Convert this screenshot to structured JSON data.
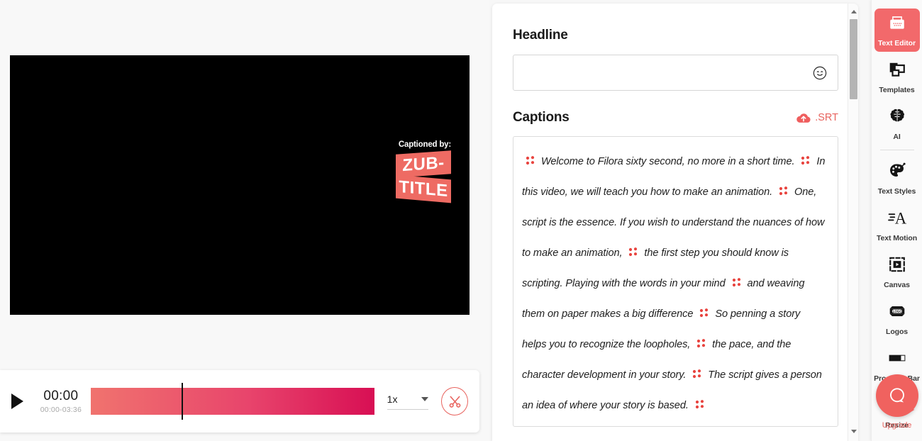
{
  "preview": {
    "watermark": {
      "caption": "Captioned by:",
      "line1": "ZUB-",
      "line2": "TITLE"
    }
  },
  "player": {
    "play_icon": "play-icon",
    "current_time": "00:00",
    "time_range": "00:00-03:36",
    "speed_value": "1x",
    "split_icon": "scissors-icon",
    "track_gradient_from": "#f0736e",
    "track_gradient_to": "#d80f54"
  },
  "editor": {
    "headline": {
      "title": "Headline",
      "value": "",
      "placeholder": "",
      "emoji_icon": "smiley-icon"
    },
    "captions": {
      "title": "Captions",
      "srt_label": ".SRT",
      "srt_icon": "cloud-upload-icon",
      "segments": [
        "Welcome to Filora sixty second, no more in a short time.",
        "In this video, we will teach you how to make an animation.",
        "One, script is the essence. If you wish to understand the nuances of how to make an animation,",
        "the first step you should know is scripting. Playing with the words in your mind",
        "and weaving them on paper makes a big difference",
        "So penning a story helps you to recognize the loopholes,",
        "the pace, and the character development in your story.",
        "The script gives a person an idea of where your story is based.",
        ""
      ]
    }
  },
  "sidebar": {
    "items": [
      {
        "label": "Text Editor",
        "icon": "text-editor-icon",
        "active": true
      },
      {
        "label": "Templates",
        "icon": "templates-icon",
        "active": false
      },
      {
        "label": "AI",
        "icon": "brain-icon",
        "active": false
      },
      {
        "label": "Text Styles",
        "icon": "palette-icon",
        "active": false
      },
      {
        "label": "Text Motion",
        "icon": "text-motion-icon",
        "active": false
      },
      {
        "label": "Canvas",
        "icon": "canvas-icon",
        "active": false
      },
      {
        "label": "Logos",
        "icon": "logo-icon",
        "active": false
      },
      {
        "label": "Progress Bar",
        "icon": "progress-bar-icon",
        "active": false
      },
      {
        "label": "Resize",
        "icon": "resize-icon",
        "active": false
      }
    ],
    "beacon": {
      "icon": "chat-bubble-icon",
      "label": "Upgrade"
    },
    "active_color": "#f2696b",
    "accent_color": "#e8635e"
  }
}
